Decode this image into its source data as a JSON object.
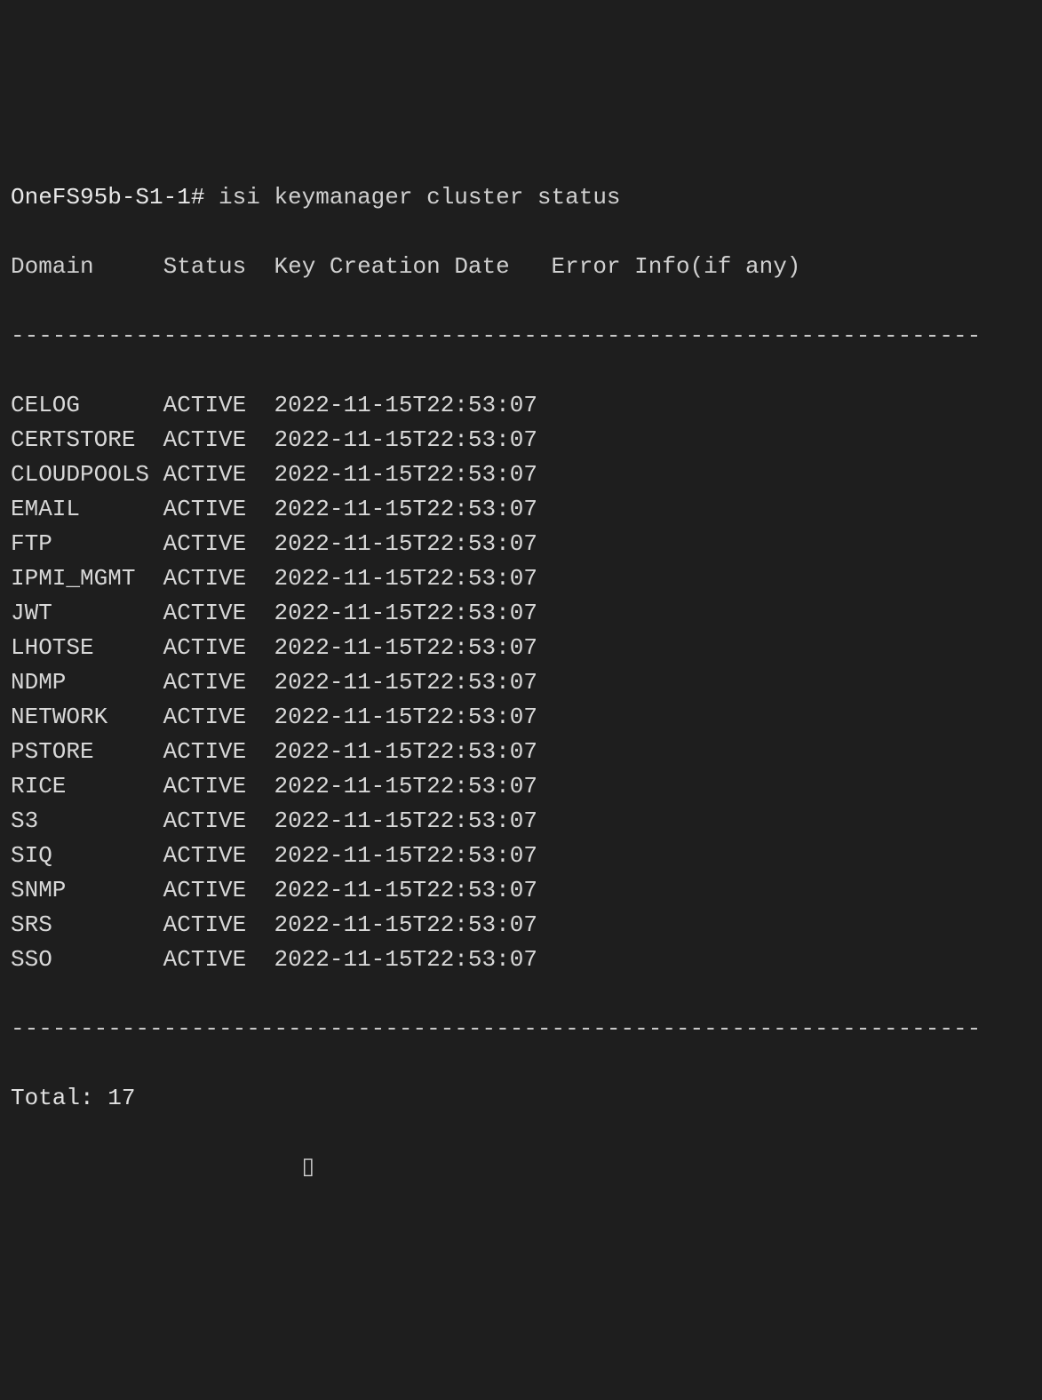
{
  "terminal": {
    "prompt": "OneFS95b-S1-1# ",
    "command": "isi keymanager cluster status",
    "headers": {
      "domain": "Domain",
      "status": "Status",
      "key_creation_date": "Key Creation Date",
      "error_info": "Error Info(if any)"
    },
    "divider": "----------------------------------------------------------------------",
    "rows": [
      {
        "domain": "CELOG",
        "status": "ACTIVE",
        "date": "2022-11-15T22:53:07",
        "error": ""
      },
      {
        "domain": "CERTSTORE",
        "status": "ACTIVE",
        "date": "2022-11-15T22:53:07",
        "error": ""
      },
      {
        "domain": "CLOUDPOOLS",
        "status": "ACTIVE",
        "date": "2022-11-15T22:53:07",
        "error": ""
      },
      {
        "domain": "EMAIL",
        "status": "ACTIVE",
        "date": "2022-11-15T22:53:07",
        "error": ""
      },
      {
        "domain": "FTP",
        "status": "ACTIVE",
        "date": "2022-11-15T22:53:07",
        "error": ""
      },
      {
        "domain": "IPMI_MGMT",
        "status": "ACTIVE",
        "date": "2022-11-15T22:53:07",
        "error": ""
      },
      {
        "domain": "JWT",
        "status": "ACTIVE",
        "date": "2022-11-15T22:53:07",
        "error": ""
      },
      {
        "domain": "LHOTSE",
        "status": "ACTIVE",
        "date": "2022-11-15T22:53:07",
        "error": ""
      },
      {
        "domain": "NDMP",
        "status": "ACTIVE",
        "date": "2022-11-15T22:53:07",
        "error": ""
      },
      {
        "domain": "NETWORK",
        "status": "ACTIVE",
        "date": "2022-11-15T22:53:07",
        "error": ""
      },
      {
        "domain": "PSTORE",
        "status": "ACTIVE",
        "date": "2022-11-15T22:53:07",
        "error": ""
      },
      {
        "domain": "RICE",
        "status": "ACTIVE",
        "date": "2022-11-15T22:53:07",
        "error": ""
      },
      {
        "domain": "S3",
        "status": "ACTIVE",
        "date": "2022-11-15T22:53:07",
        "error": ""
      },
      {
        "domain": "SIQ",
        "status": "ACTIVE",
        "date": "2022-11-15T22:53:07",
        "error": ""
      },
      {
        "domain": "SNMP",
        "status": "ACTIVE",
        "date": "2022-11-15T22:53:07",
        "error": ""
      },
      {
        "domain": "SRS",
        "status": "ACTIVE",
        "date": "2022-11-15T22:53:07",
        "error": ""
      },
      {
        "domain": "SSO",
        "status": "ACTIVE",
        "date": "2022-11-15T22:53:07",
        "error": ""
      }
    ],
    "total": "Total: 17",
    "cursor": "                     ▯"
  }
}
